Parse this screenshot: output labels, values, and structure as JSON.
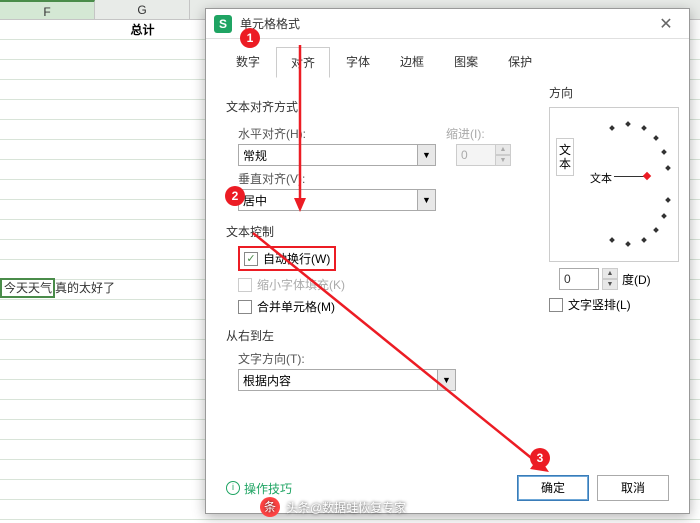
{
  "sheet": {
    "col_f": "F",
    "col_g": "G",
    "total_label": "总计",
    "active_text": "今天天气",
    "overflow_text": "真的太好了"
  },
  "dialog": {
    "app_icon": "S",
    "title": "单元格格式",
    "tabs": [
      "数字",
      "对齐",
      "字体",
      "边框",
      "图案",
      "保护"
    ],
    "align_section": "文本对齐方式",
    "h_align_label": "水平对齐(H):",
    "h_align_value": "常规",
    "indent_label": "缩进(I):",
    "indent_value": "0",
    "v_align_label": "垂直对齐(V):",
    "v_align_value": "居中",
    "control_section": "文本控制",
    "wrap_label": "自动换行(W)",
    "shrink_label": "缩小字体填充(K)",
    "merge_label": "合并单元格(M)",
    "rtl_section": "从右到左",
    "text_dir_label": "文字方向(T):",
    "text_dir_value": "根据内容",
    "direction_section": "方向",
    "dir_vert_text": "文本",
    "dir_circle_text": "文本",
    "degree_value": "0",
    "degree_label": "度(D)",
    "vertical_label": "文字竖排(L)",
    "tips_label": "操作技巧",
    "ok_label": "确定",
    "cancel_label": "取消"
  },
  "watermark": "头条@数据蛙恢复专家"
}
